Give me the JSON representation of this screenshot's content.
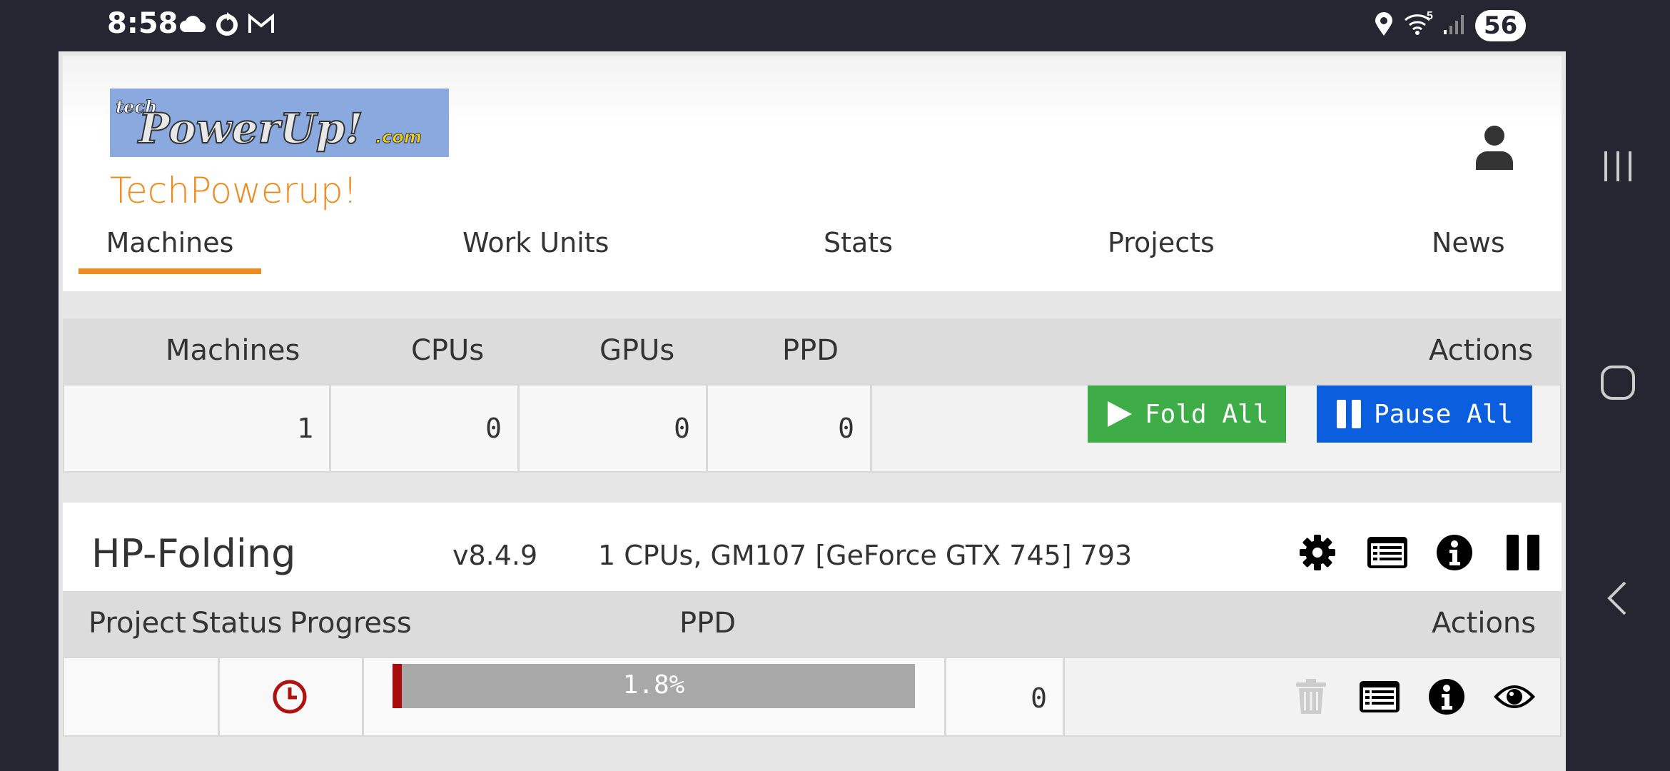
{
  "status_bar": {
    "time": "8:58",
    "left_icons": [
      "cloud-icon",
      "sync-icon",
      "gmail-icon"
    ],
    "right_icons": [
      "location-icon",
      "wifi-icon",
      "signal-icon"
    ],
    "wifi_label": "5",
    "battery": "56"
  },
  "header": {
    "logo_text": "techPowerUp!.com",
    "site_title": "TechPowerup!",
    "accent_color": "#ed8b1f"
  },
  "tabs": [
    {
      "label": "Machines",
      "active": true
    },
    {
      "label": "Work Units",
      "active": false
    },
    {
      "label": "Stats",
      "active": false
    },
    {
      "label": "Projects",
      "active": false
    },
    {
      "label": "News",
      "active": false
    }
  ],
  "summary": {
    "headers": {
      "machines": "Machines",
      "cpus": "CPUs",
      "gpus": "GPUs",
      "ppd": "PPD",
      "actions": "Actions"
    },
    "values": {
      "machines": "1",
      "cpus": "0",
      "gpus": "0",
      "ppd": "0"
    },
    "fold_all": "Fold All",
    "pause_all": "Pause All"
  },
  "machine": {
    "name": "HP-Folding",
    "version": "v8.4.9",
    "hardware": "1 CPUs, GM107 [GeForce GTX 745] 793",
    "icons": [
      "gear-icon",
      "log-icon",
      "info-icon",
      "pause-icon"
    ],
    "wu_headers": {
      "project": "Project",
      "status": "Status",
      "progress": "Progress",
      "ppd": "PPD",
      "actions": "Actions"
    },
    "work_unit": {
      "project": "",
      "status_icon": "clock-icon",
      "progress_text": "1.8%",
      "progress_value": 0.018,
      "ppd": "0",
      "action_icons": [
        "trash-icon",
        "log-icon",
        "info-icon",
        "eye-icon"
      ]
    }
  }
}
